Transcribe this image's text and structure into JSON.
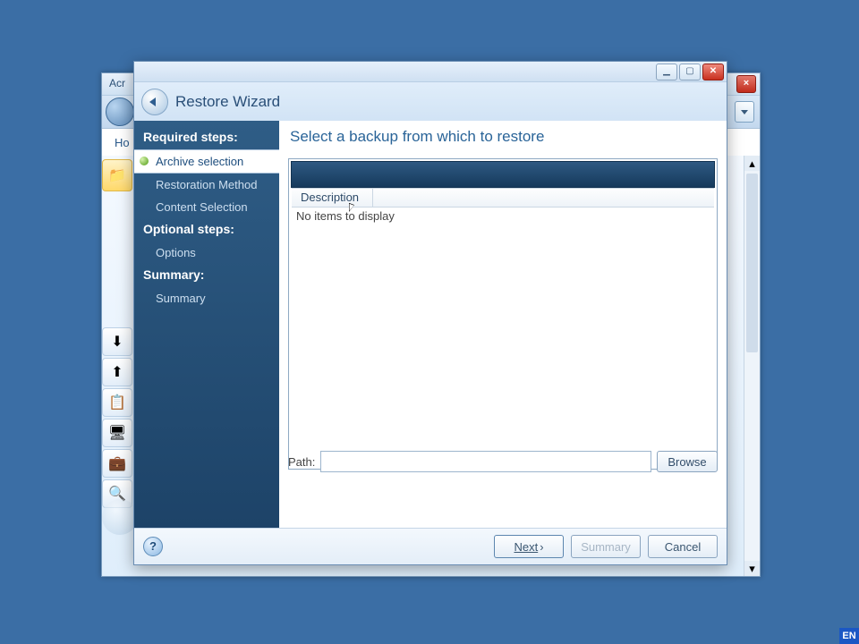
{
  "bg": {
    "title": "Acr",
    "tab": "Ho",
    "close_glyph": "×",
    "dropdown_glyph": "▾",
    "side_icons": [
      "folder-icon",
      "sync-down-icon",
      "sync-up-icon",
      "clipboard-icon",
      "monitor-icon",
      "briefcase-icon",
      "search-icon"
    ]
  },
  "wizard": {
    "title": "Restore Wizard",
    "window_buttons": {
      "minimize": "▁",
      "maximize": "▢",
      "close": "✕"
    },
    "sidebar": {
      "section_required": "Required steps:",
      "steps_required": [
        {
          "label": "Archive selection",
          "active": true
        },
        {
          "label": "Restoration Method",
          "active": false
        },
        {
          "label": "Content Selection",
          "active": false
        }
      ],
      "section_optional": "Optional steps:",
      "steps_optional": [
        {
          "label": "Options"
        }
      ],
      "section_summary": "Summary:",
      "steps_summary": [
        {
          "label": "Summary"
        }
      ]
    },
    "main": {
      "heading": "Select a backup from which to restore",
      "column_header": "Description",
      "empty_text": "No items to display",
      "path_label": "Path:",
      "path_value": "",
      "browse_label": "Browse"
    },
    "footer": {
      "help_glyph": "?",
      "next": "Next",
      "next_chevron": "›",
      "summary": "Summary",
      "cancel": "Cancel"
    }
  },
  "lang": "EN"
}
